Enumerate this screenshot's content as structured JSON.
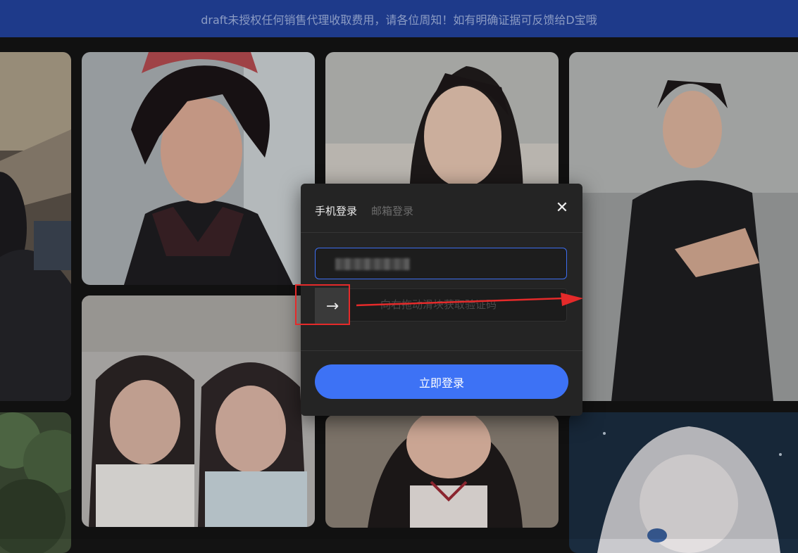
{
  "notice": {
    "text": "draft未授权任何销售代理收取费用，请各位周知！如有明确证据可反馈给D宝哦"
  },
  "login_modal": {
    "tabs": [
      {
        "label": "手机登录",
        "active": true
      },
      {
        "label": "邮箱登录",
        "active": false
      }
    ],
    "close_icon": "close-icon",
    "phone_value": "",
    "slider": {
      "hint": "向右拖动滑块获取验证码",
      "handle_icon": "arrow-right-icon",
      "progress": 0
    },
    "submit_label": "立即登录"
  },
  "annotation": {
    "color": "#e52a2a"
  },
  "colors": {
    "accent": "#3d72f5",
    "banner": "#1e3a8a"
  }
}
